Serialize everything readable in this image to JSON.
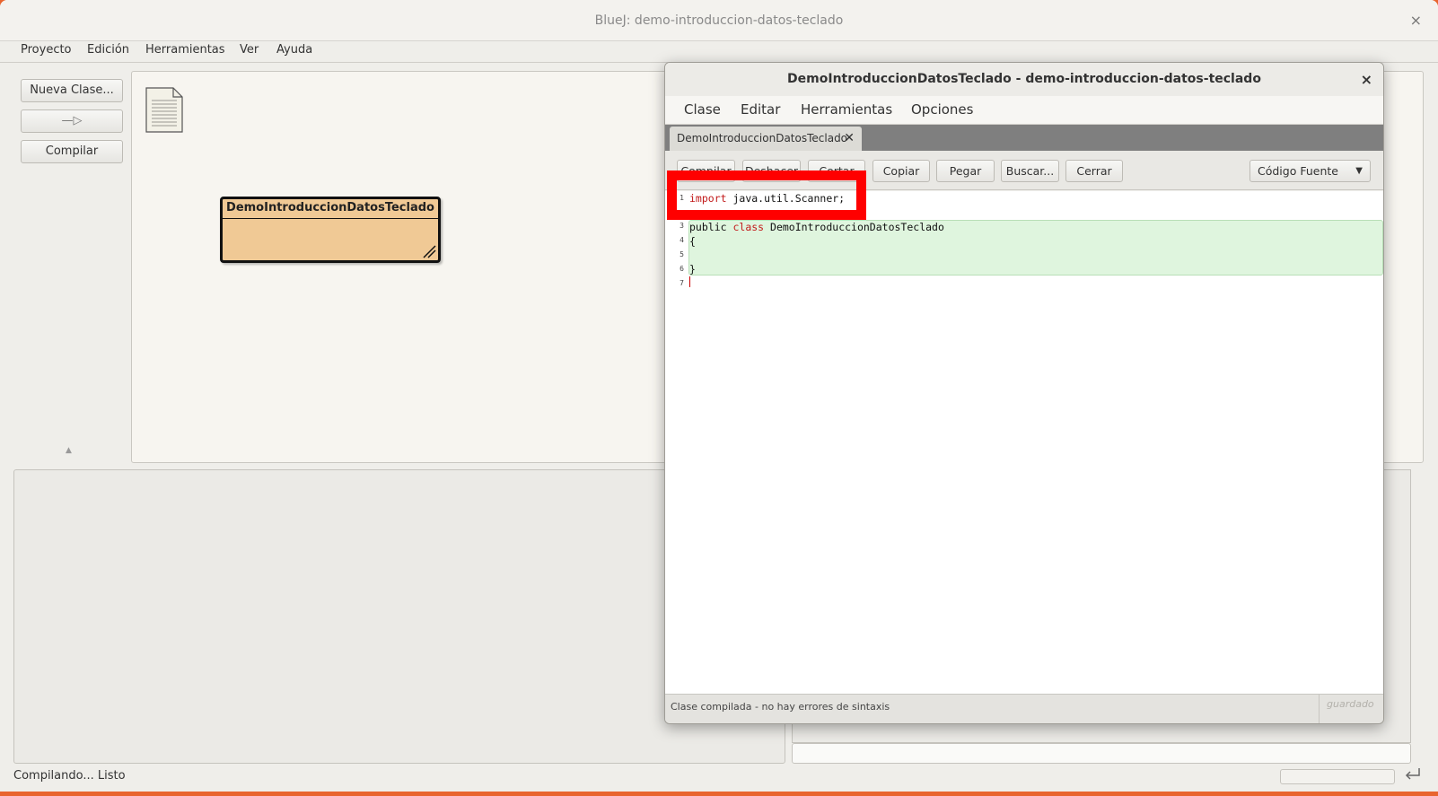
{
  "window": {
    "title": "BlueJ: demo-introduccion-datos-teclado",
    "close_glyph": "×"
  },
  "menu": [
    "Proyecto",
    "Edición",
    "Herramientas",
    "Ver",
    "Ayuda"
  ],
  "left_panel": {
    "new_class": "Nueva Clase...",
    "compile": "Compilar",
    "arrow_glyph": "—▷",
    "collapse_glyph": "▲"
  },
  "class_diagram": {
    "class_name": "DemoIntroduccionDatosTeclado"
  },
  "status": {
    "text": "Compilando... Listo"
  },
  "editor": {
    "title": "DemoIntroduccionDatosTeclado - demo-introduccion-datos-teclado",
    "close_glyph": "×",
    "menu": [
      "Clase",
      "Editar",
      "Herramientas",
      "Opciones"
    ],
    "tab": {
      "label": "DemoIntroduccionDatosTeclado",
      "close_glyph": "✕"
    },
    "toolbar": [
      "Compilar",
      "Deshacer",
      "Cortar",
      "Copiar",
      "Pegar",
      "Buscar...",
      "Cerrar"
    ],
    "view_select": {
      "value": "Código Fuente",
      "arrow_glyph": "▼"
    },
    "line_numbers": [
      "1",
      "3",
      "4",
      "5",
      "6",
      "7"
    ],
    "code": {
      "line1_kw": "import",
      "line1_rest": " java.util.Scanner;",
      "line3_kw1": "public",
      "line3_kw2": "class",
      "line3_name": " DemoIntroduccionDatosTeclado",
      "line4": "{",
      "line6": "}"
    },
    "status_message": "Clase compilada - no hay errores de sintaxis",
    "saved_label": "guardado"
  },
  "colors": {
    "class_fill": "#f0c995",
    "highlight": "#ff0000",
    "keyword": "#c21b1b",
    "scope_green": "#dff5de"
  }
}
